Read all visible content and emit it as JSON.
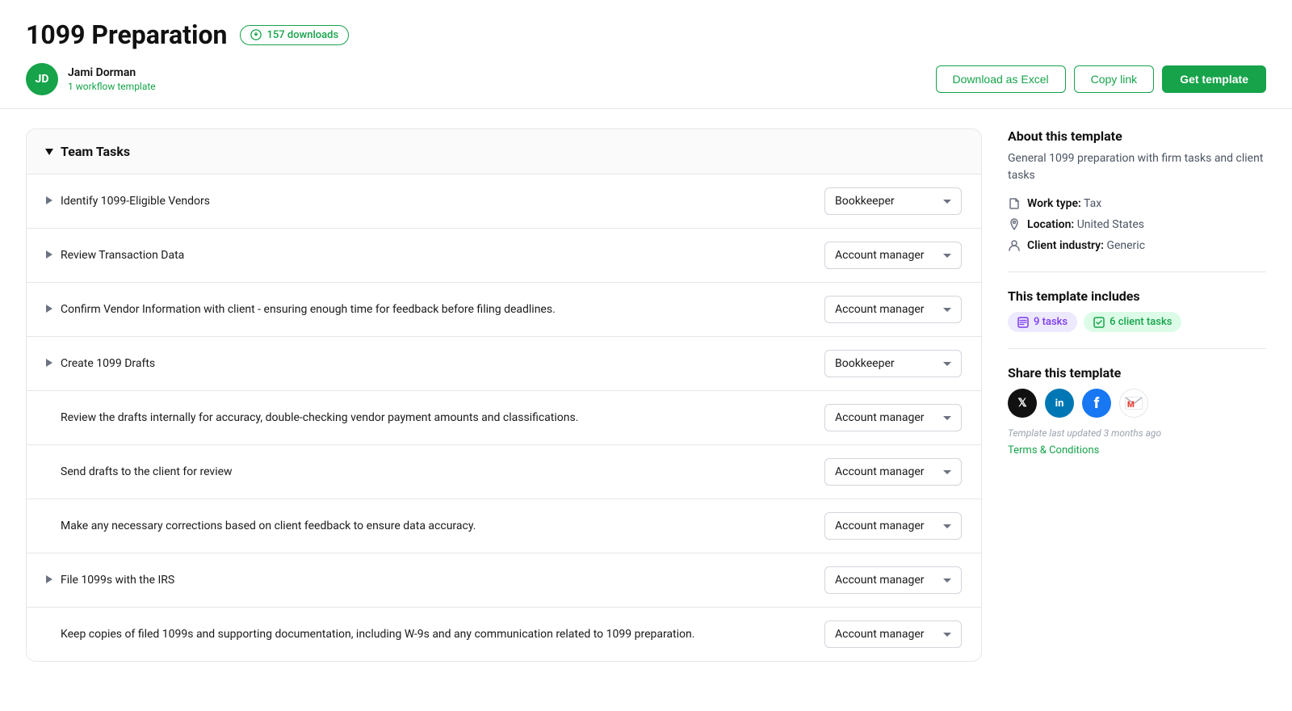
{
  "header": {
    "title": "1099 Preparation",
    "downloads_count": "157 downloads",
    "author": {
      "initials": "JD",
      "name": "Jami Dorman",
      "sub": "1 workflow template"
    },
    "actions": {
      "download_excel": "Download as Excel",
      "copy_link": "Copy link",
      "get_template": "Get template"
    }
  },
  "tasks_section": {
    "group_title": "Team Tasks",
    "tasks": [
      {
        "id": 1,
        "text": "Identify 1099-Eligible Vendors",
        "role": "Bookkeeper",
        "has_arrow": true,
        "indented": false
      },
      {
        "id": 2,
        "text": "Review Transaction Data",
        "role": "Account manager",
        "has_arrow": true,
        "indented": false
      },
      {
        "id": 3,
        "text": "Confirm Vendor Information with client - ensuring enough time for feedback before filing deadlines.",
        "role": "Account manager",
        "has_arrow": true,
        "indented": false
      },
      {
        "id": 4,
        "text": "Create 1099 Drafts",
        "role": "Bookkeeper",
        "has_arrow": true,
        "indented": false
      },
      {
        "id": 5,
        "text": "Review the drafts internally for accuracy, double-checking vendor payment amounts and classifications.",
        "role": "Account manager",
        "has_arrow": false,
        "indented": true
      },
      {
        "id": 6,
        "text": "Send drafts to the client for review",
        "role": "Account manager",
        "has_arrow": false,
        "indented": true
      },
      {
        "id": 7,
        "text": "Make any necessary corrections based on client feedback to ensure data accuracy.",
        "role": "Account manager",
        "has_arrow": false,
        "indented": true
      },
      {
        "id": 8,
        "text": "File 1099s with the IRS",
        "role": "Account manager",
        "has_arrow": true,
        "indented": false
      },
      {
        "id": 9,
        "text": "Keep copies of filed 1099s and supporting documentation, including W-9s and any communication related to 1099 preparation.",
        "role": "Account manager",
        "has_arrow": false,
        "indented": true
      }
    ]
  },
  "sidebar": {
    "about_title": "About this template",
    "about_desc": "General 1099 preparation with firm tasks and client tasks",
    "work_type_label": "Work type:",
    "work_type_value": "Tax",
    "location_label": "Location:",
    "location_value": "United States",
    "client_industry_label": "Client industry:",
    "client_industry_value": "Generic",
    "includes_title": "This template includes",
    "badge_tasks": "9 tasks",
    "badge_client_tasks": "6 client tasks",
    "share_title": "Share this template",
    "template_updated": "Template last updated 3 months ago",
    "terms_link": "Terms & Conditions"
  }
}
